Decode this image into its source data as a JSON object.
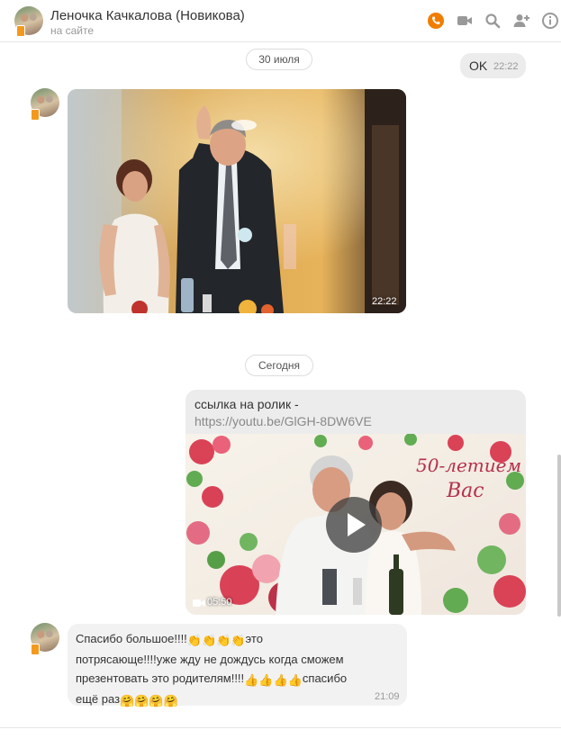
{
  "header": {
    "name": "Леночка Качкалова (Новикова)",
    "status": "на сайте",
    "icons": [
      "phone-icon",
      "video-call-icon",
      "search-icon",
      "add-user-icon",
      "info-icon"
    ],
    "accent_color": "#f07d00"
  },
  "dates": {
    "first": "30 июля",
    "second": "Сегодня"
  },
  "messages": {
    "ok": {
      "text": "OK",
      "time": "22:22"
    },
    "photo": {
      "time": "22:22"
    },
    "link": {
      "text": "ссылка на ролик -",
      "url": "https://youtu.be/GlGH-8DW6VE",
      "video_duration": "05:50",
      "video_title_text": "50-летием Вас"
    },
    "thanks": {
      "line1": "Спасибо большое!!!!",
      "line1b": "это",
      "line2": "потрясающе!!!!уже жду не дождусь когда сможем",
      "line3": "презентовать это родителям!!!!",
      "line3b": "спасибо",
      "line4": "ещё раз",
      "time": "21:09"
    }
  }
}
